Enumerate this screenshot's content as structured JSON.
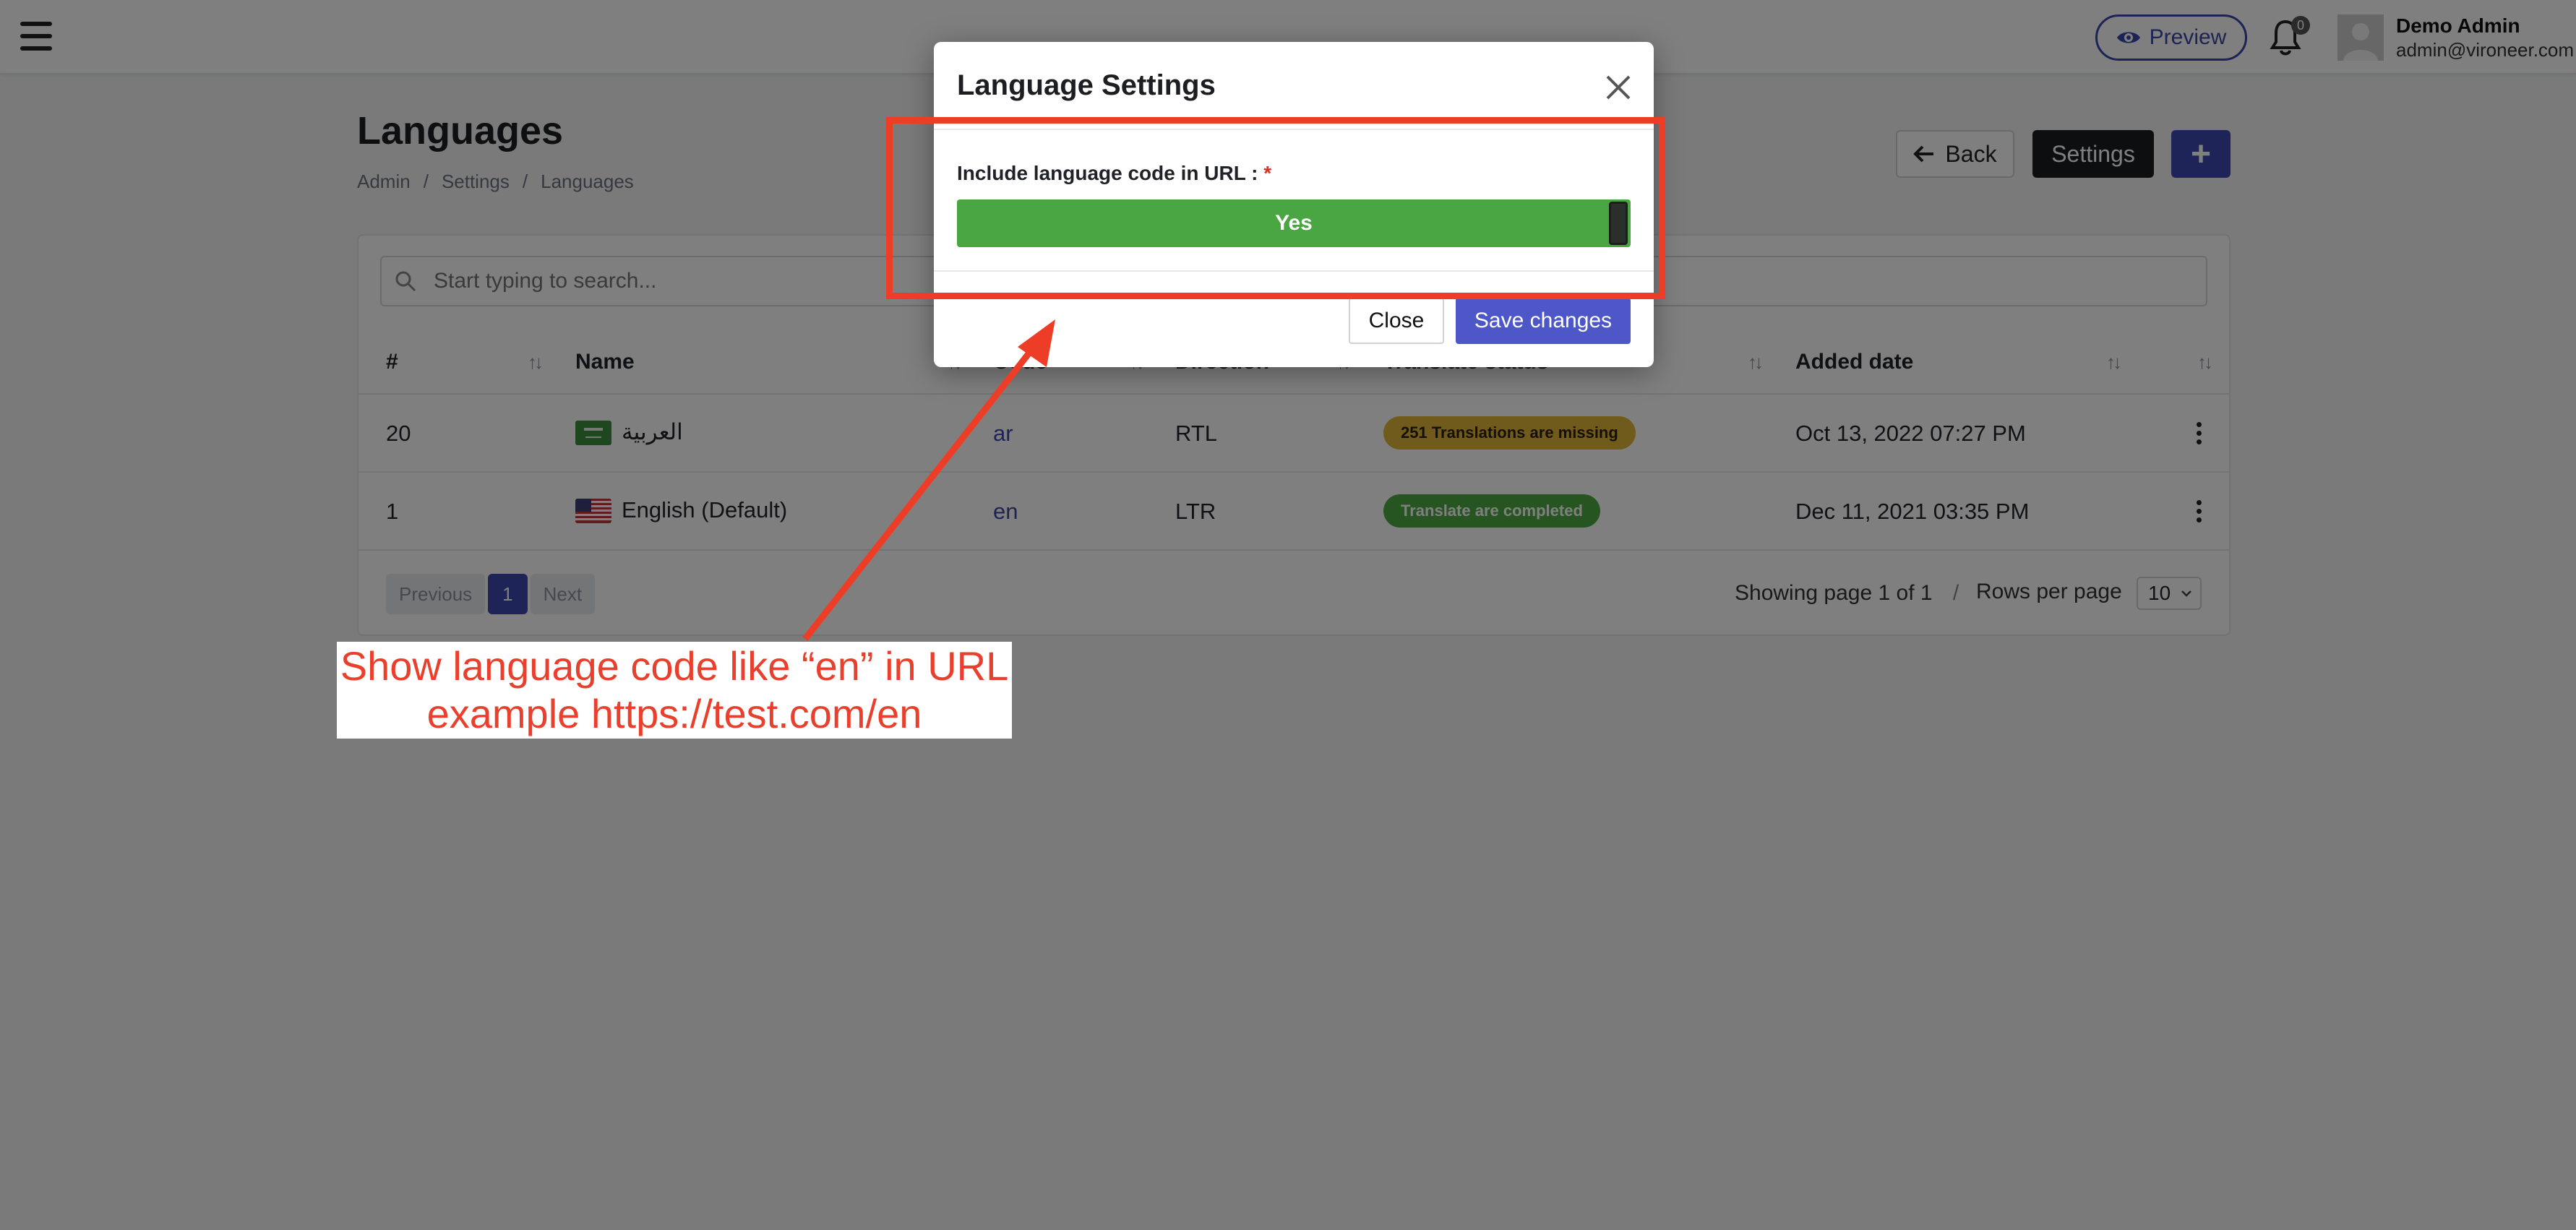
{
  "topbar": {
    "preview_label": "Preview",
    "notification_count": "0",
    "user_name": "Demo Admin",
    "user_email": "admin@vironeer.com"
  },
  "page": {
    "title": "Languages",
    "breadcrumb": [
      "Admin",
      "/",
      "Settings",
      "/",
      "Languages"
    ],
    "back_label": "Back",
    "settings_label": "Settings",
    "add_label": "+"
  },
  "search": {
    "placeholder": "Start typing to search..."
  },
  "table": {
    "headers": [
      "#",
      "Name",
      "Code",
      "Direction",
      "Translate status",
      "Added date"
    ],
    "rows": [
      {
        "id": "20",
        "name": "العربية",
        "code": "ar",
        "direction": "RTL",
        "status": "251 Translations are missing",
        "status_color": "#e0b63a",
        "added": "Oct 13, 2022 07:27 PM"
      },
      {
        "id": "1",
        "name": "English (Default)",
        "code": "en",
        "direction": "LTR",
        "status": "Translate are completed",
        "status_color": "#4caa43",
        "added": "Dec 11, 2021 03:35 PM"
      }
    ]
  },
  "pagination": {
    "previous": "Previous",
    "current": "1",
    "next": "Next",
    "showing": "Showing page 1 of 1",
    "separator": "/",
    "rows_label": "Rows per page",
    "rows_value": "10"
  },
  "modal": {
    "title": "Language Settings",
    "field_label": "Include language code in URL :",
    "required_mark": "*",
    "toggle_value": "Yes",
    "close_label": "Close",
    "save_label": "Save changes"
  },
  "annotation": {
    "line1": "Show language code like “en” in URL",
    "line2": "example https://test.com/en",
    "color": "#ee3d27"
  }
}
